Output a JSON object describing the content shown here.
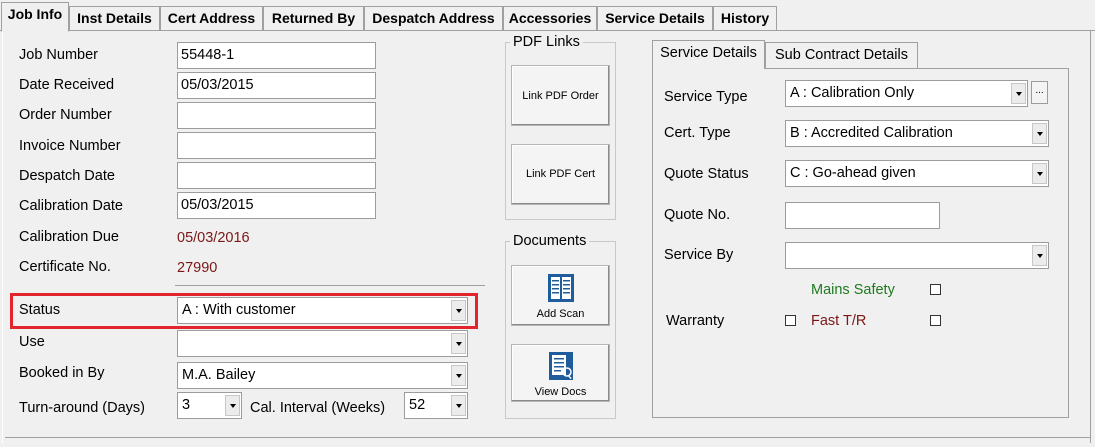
{
  "tabs": [
    "Job Info",
    "Inst Details",
    "Cert Address",
    "Returned By",
    "Despatch Address",
    "Accessories",
    "Service Details",
    "History"
  ],
  "job": {
    "job_number_label": "Job Number",
    "job_number": "55448-1",
    "date_received_label": "Date Received",
    "date_received": "05/03/2015",
    "order_number_label": "Order Number",
    "order_number": "",
    "invoice_number_label": "Invoice Number",
    "invoice_number": "",
    "despatch_date_label": "Despatch Date",
    "despatch_date": "",
    "calibration_date_label": "Calibration Date",
    "calibration_date": "05/03/2015",
    "calibration_due_label": "Calibration Due",
    "calibration_due": "05/03/2016",
    "certificate_no_label": "Certificate No.",
    "certificate_no": "27990",
    "status_label": "Status",
    "status": "A : With customer",
    "use_label": "Use",
    "use": "",
    "booked_in_by_label": "Booked in By",
    "booked_in_by": "M.A. Bailey",
    "turnaround_label": "Turn-around (Days)",
    "turnaround": "3",
    "cal_interval_label": "Cal. Interval (Weeks)",
    "cal_interval": "52"
  },
  "pdf_links": {
    "title": "PDF Links",
    "link_order": "Link PDF Order",
    "link_cert": "Link PDF Cert"
  },
  "documents": {
    "title": "Documents",
    "add_scan": "Add Scan",
    "view_docs": "View Docs"
  },
  "subtabs": [
    "Service Details",
    "Sub Contract Details"
  ],
  "service": {
    "service_type_label": "Service Type",
    "service_type": "A : Calibration Only",
    "ellipsis": "...",
    "cert_type_label": "Cert. Type",
    "cert_type": "B : Accredited Calibration",
    "quote_status_label": "Quote Status",
    "quote_status": "C : Go-ahead given",
    "quote_no_label": "Quote No.",
    "quote_no": "",
    "service_by_label": "Service By",
    "service_by": "",
    "mains_safety_label": "Mains Safety",
    "warranty_label": "Warranty",
    "fast_tr_label": "Fast T/R"
  },
  "colors": {
    "due_red": "#7b1616",
    "mains_green": "#1e7a1e",
    "fast_red": "#7b1616",
    "highlight": "#e2242c"
  }
}
